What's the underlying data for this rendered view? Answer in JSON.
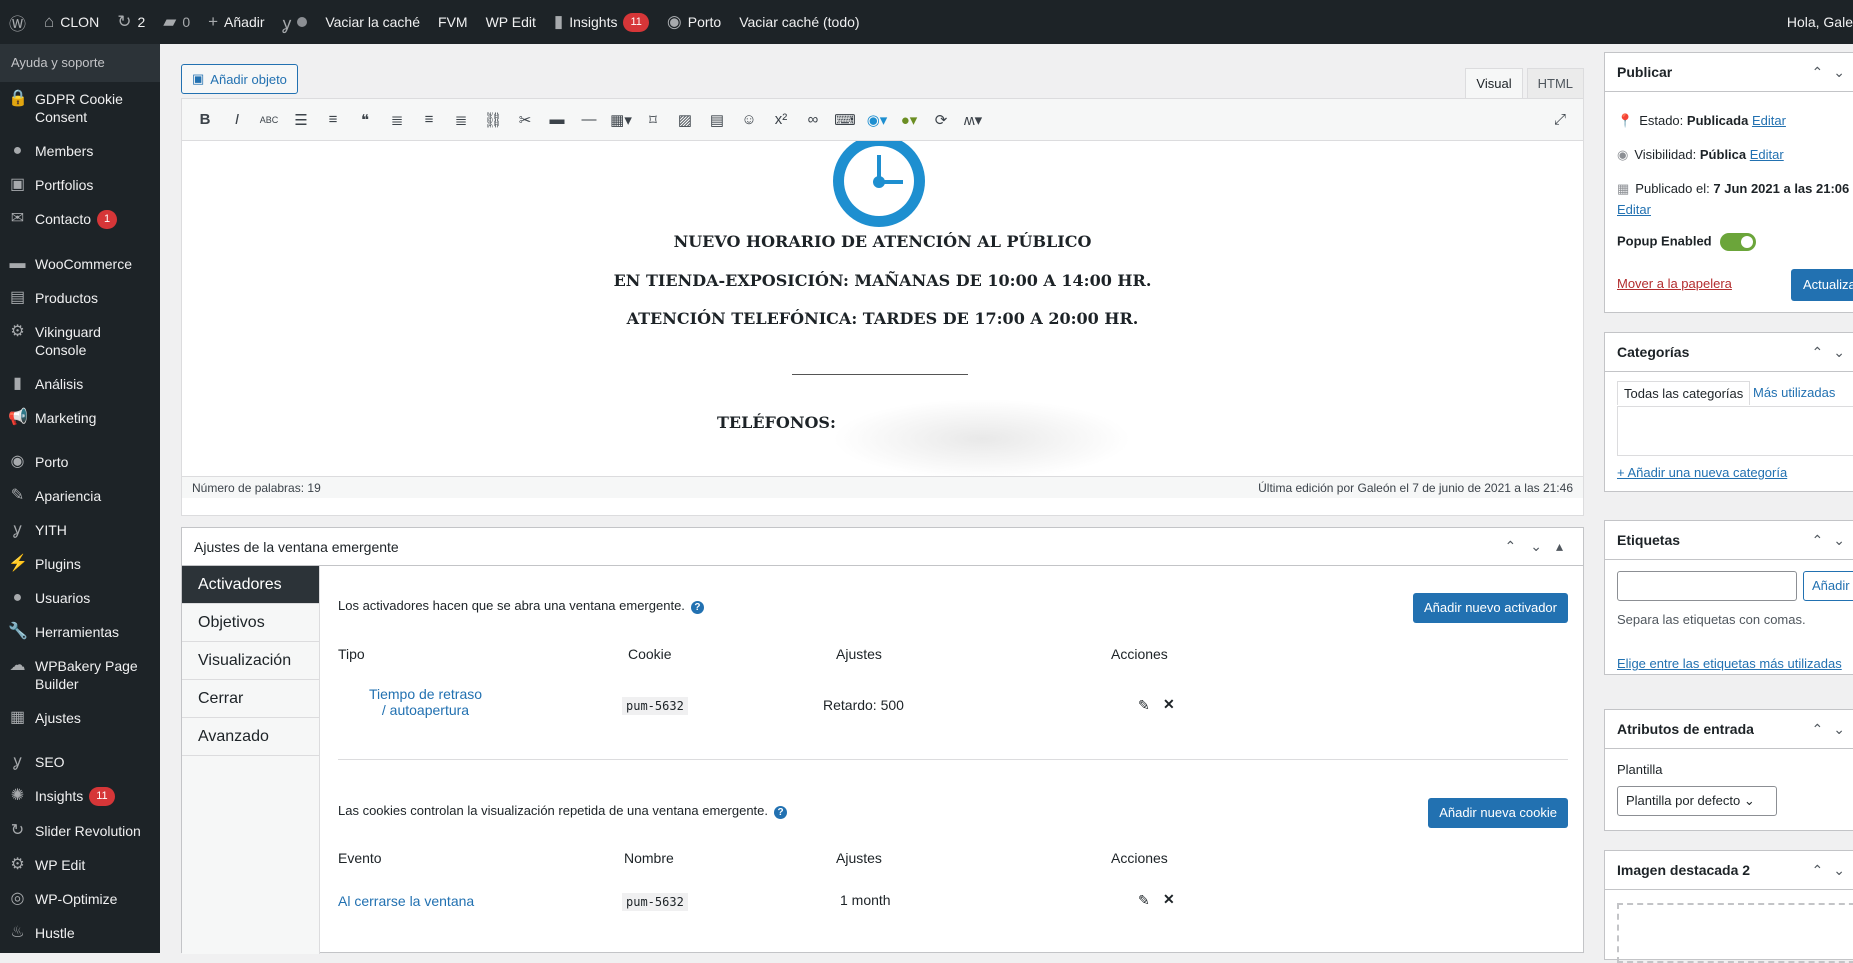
{
  "adminbar": {
    "site": "CLON",
    "updates": "2",
    "comments": "0",
    "new": "Añadir",
    "cache": "Vaciar la caché",
    "fvm": "FVM",
    "wpedit": "WP Edit",
    "insights": "Insights",
    "insights_count": "11",
    "porto": "Porto",
    "cache_all": "Vaciar caché (todo)",
    "greeting": "Hola, Gale"
  },
  "sidebar": {
    "help": "Ayuda y soporte",
    "items": [
      {
        "label": "GDPR Cookie Consent",
        "icon": "lock-icon"
      },
      {
        "label": "Members",
        "icon": "user-icon"
      },
      {
        "label": "Portfolios",
        "icon": "portfolio-icon"
      },
      {
        "label": "Contacto",
        "icon": "mail-icon",
        "badge": "1"
      },
      {
        "label": "WooCommerce",
        "icon": "woo-icon"
      },
      {
        "label": "Productos",
        "icon": "archive-icon"
      },
      {
        "label": "Vikinguard Console",
        "icon": "gear-icon"
      },
      {
        "label": "Análisis",
        "icon": "bar-chart-icon"
      },
      {
        "label": "Marketing",
        "icon": "megaphone-icon"
      },
      {
        "label": "Porto",
        "icon": "porto-icon"
      },
      {
        "label": "Apariencia",
        "icon": "brush-icon"
      },
      {
        "label": "YITH",
        "icon": "yith-icon"
      },
      {
        "label": "Plugins",
        "icon": "plugin-icon"
      },
      {
        "label": "Usuarios",
        "icon": "user-icon"
      },
      {
        "label": "Herramientas",
        "icon": "wrench-icon"
      },
      {
        "label": "WPBakery Page Builder",
        "icon": "cloud-icon"
      },
      {
        "label": "Ajustes",
        "icon": "settings-icon"
      },
      {
        "label": "SEO",
        "icon": "yoast-icon"
      },
      {
        "label": "Insights",
        "icon": "insights-icon",
        "badge": "11"
      },
      {
        "label": "Slider Revolution",
        "icon": "refresh-icon"
      },
      {
        "label": "WP Edit",
        "icon": "gear-icon"
      },
      {
        "label": "WP-Optimize",
        "icon": "optimize-icon"
      },
      {
        "label": "Hustle",
        "icon": "hustle-icon"
      }
    ]
  },
  "editor": {
    "add_media": "Añadir objeto",
    "tab_visual": "Visual",
    "tab_html": "HTML",
    "line1": "NUEVO HORARIO DE ATENCIÓN AL PÚBLICO",
    "line2": "EN TIENDA-EXPOSICIÓN: MAÑANAS DE 10:00 A 14:00 HR.",
    "line3": "ATENCIÓN TELEFÓNICA: TARDES DE 17:00 A 20:00 HR.",
    "line4": "TELÉFONOS:",
    "word_count": "Número de palabras: 19",
    "last_edit": "Última edición por Galeón el 7 de junio de 2021 a las 21:46"
  },
  "popup_settings": {
    "title": "Ajustes de la ventana emergente",
    "tabs": [
      "Activadores",
      "Objetivos",
      "Visualización",
      "Cerrar",
      "Avanzado"
    ],
    "triggers_note": "Los activadores hacen que se abra una ventana emergente.",
    "add_trigger": "Añadir nuevo activador",
    "trig_cols": [
      "Tipo",
      "Cookie",
      "Ajustes",
      "Acciones"
    ],
    "trig_row": {
      "type": "Tiempo de retraso / autoapertura",
      "cookie": "pum-5632",
      "settings_label": "Retardo:",
      "settings_value": "500"
    },
    "cookies_note": "Las cookies controlan la visualización repetida de una ventana emergente.",
    "add_cookie": "Añadir nueva cookie",
    "cookie_cols": [
      "Evento",
      "Nombre",
      "Ajustes",
      "Acciones"
    ],
    "cookie_row": {
      "event": "Al cerrarse la ventana",
      "name": "pum-5632",
      "settings": "1 month"
    }
  },
  "publish": {
    "title": "Publicar",
    "status_label": "Estado:",
    "status_value": "Publicada",
    "edit": "Editar",
    "visibility_label": "Visibilidad:",
    "visibility_value": "Pública",
    "published_label": "Publicado el:",
    "published_value": "7 Jun 2021 a las 21:06",
    "popup_enabled": "Popup Enabled",
    "trash": "Mover a la papelera",
    "update": "Actualiza"
  },
  "categories": {
    "title": "Categorías",
    "tab_all": "Todas las categorías",
    "tab_used": "Más utilizadas",
    "add_new": "+ Añadir una nueva categoría"
  },
  "tags": {
    "title": "Etiquetas",
    "add": "Añadir",
    "hint": "Separa las etiquetas con comas.",
    "choose": "Elige entre las etiquetas más utilizadas"
  },
  "attributes": {
    "title": "Atributos de entrada",
    "template_label": "Plantilla",
    "template_value": "Plantilla por defecto"
  },
  "featured": {
    "title": "Imagen destacada 2"
  },
  "colors": {
    "accent": "#2271b1",
    "adminbar": "#1d2327",
    "badge": "#d63638",
    "toggle": "#6ba53a"
  }
}
